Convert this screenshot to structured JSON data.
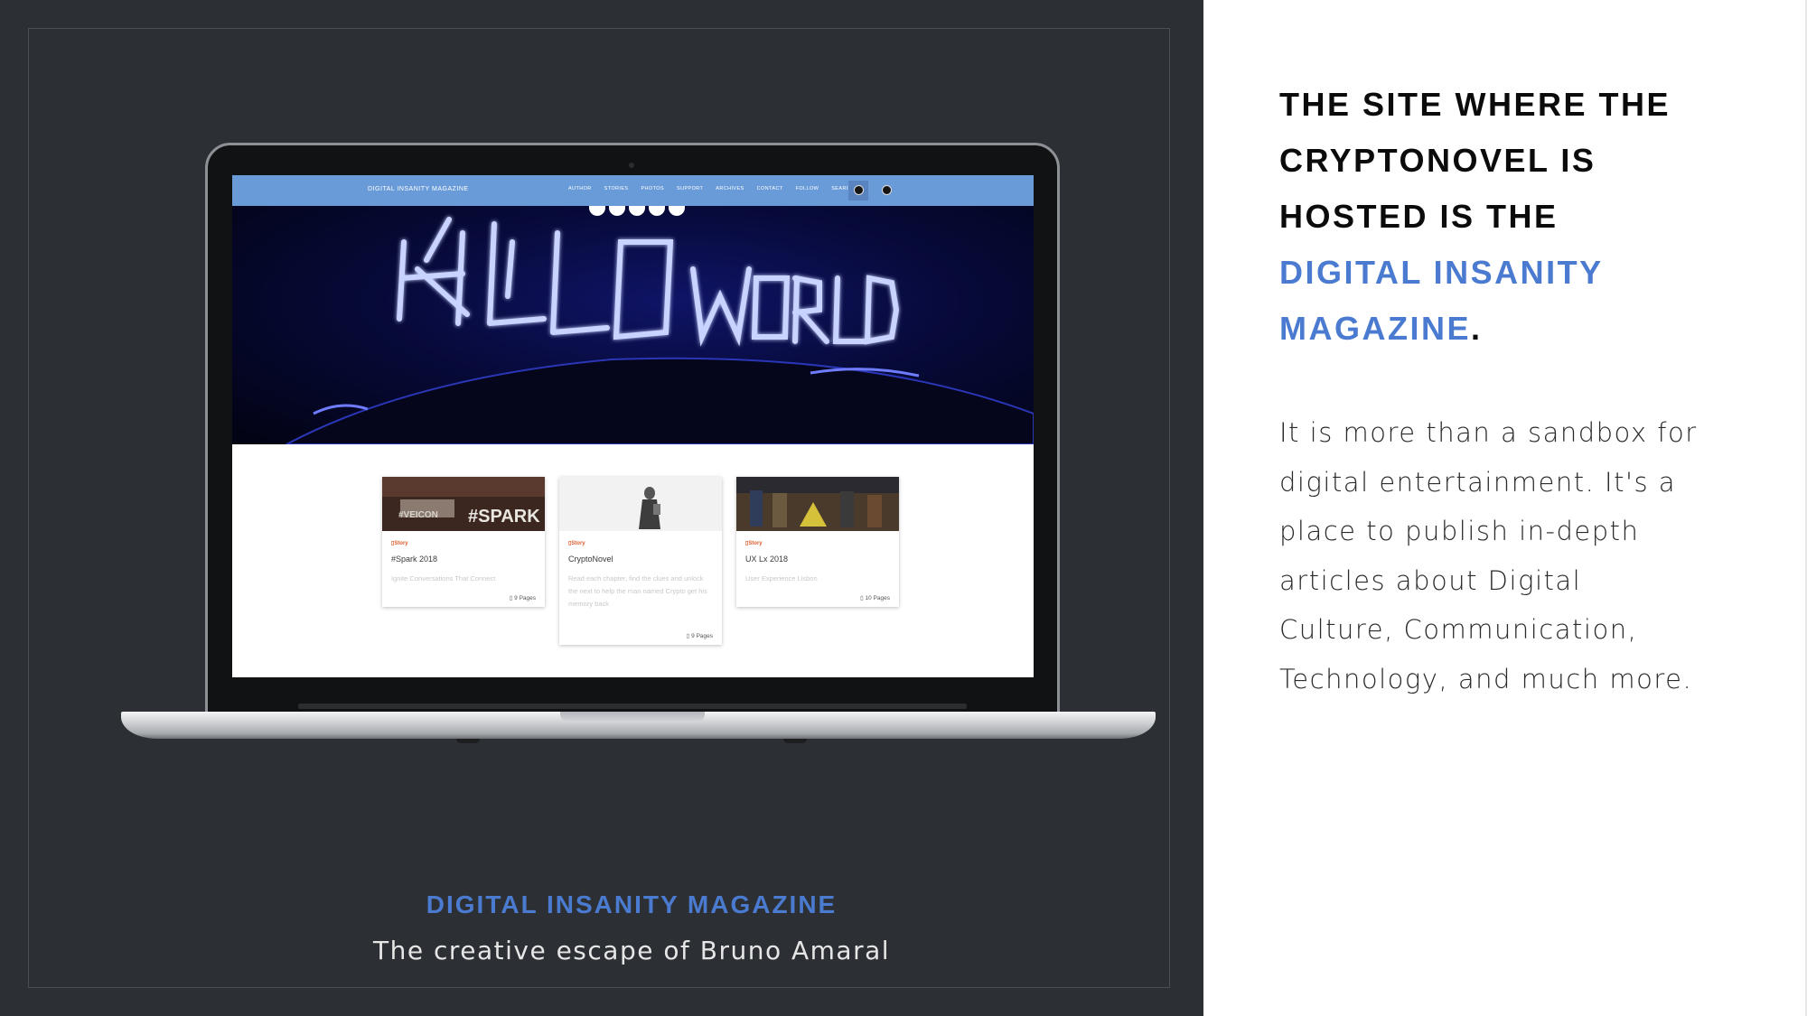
{
  "headline": {
    "line_1": "THE SITE WHERE THE",
    "line_2": "CRYPTONOVEL IS",
    "line_3": "HOSTED IS THE",
    "accent_1": "DIGITAL INSANITY",
    "accent_2": "MAGAZINE",
    "period": "."
  },
  "body_paragraph": "It is more than a sandbox for digital entertainment. It's a place to publish in-depth articles about Digital Culture, Communication, Technology, and much more.",
  "caption": {
    "title": "DIGITAL INSANITY MAGAZINE",
    "subtitle": "The creative escape of Bruno Amaral"
  },
  "website": {
    "brand": "DIGITAL INSANITY MAGAZINE",
    "menu": [
      "AUTHOR",
      "STORIES",
      "PHOTOS",
      "SUPPORT",
      "ARCHIVES",
      "CONTACT",
      "FOLLOW",
      "SEARCH"
    ],
    "hero_sign": "HELLO WORLD",
    "cards": [
      {
        "tag": "Story",
        "title": "#Spark 2018",
        "desc": "Ignite Conversations That Connect",
        "pages": "9 Pages"
      },
      {
        "tag": "Story",
        "title": "CryptoNovel",
        "desc": "Read each chapter, find the clues and unlock the next to help the man named Crypto get his memory back",
        "pages": "9 Pages"
      },
      {
        "tag": "Story",
        "title": "UX Lx 2018",
        "desc": "User Experience Lisbon",
        "pages": "10 Pages"
      }
    ]
  },
  "colors": {
    "accent": "#4a7bd0",
    "dark_bg": "#2c3034",
    "nav_bar": "#6a9bd9",
    "story_tag": "#e05a2a"
  }
}
